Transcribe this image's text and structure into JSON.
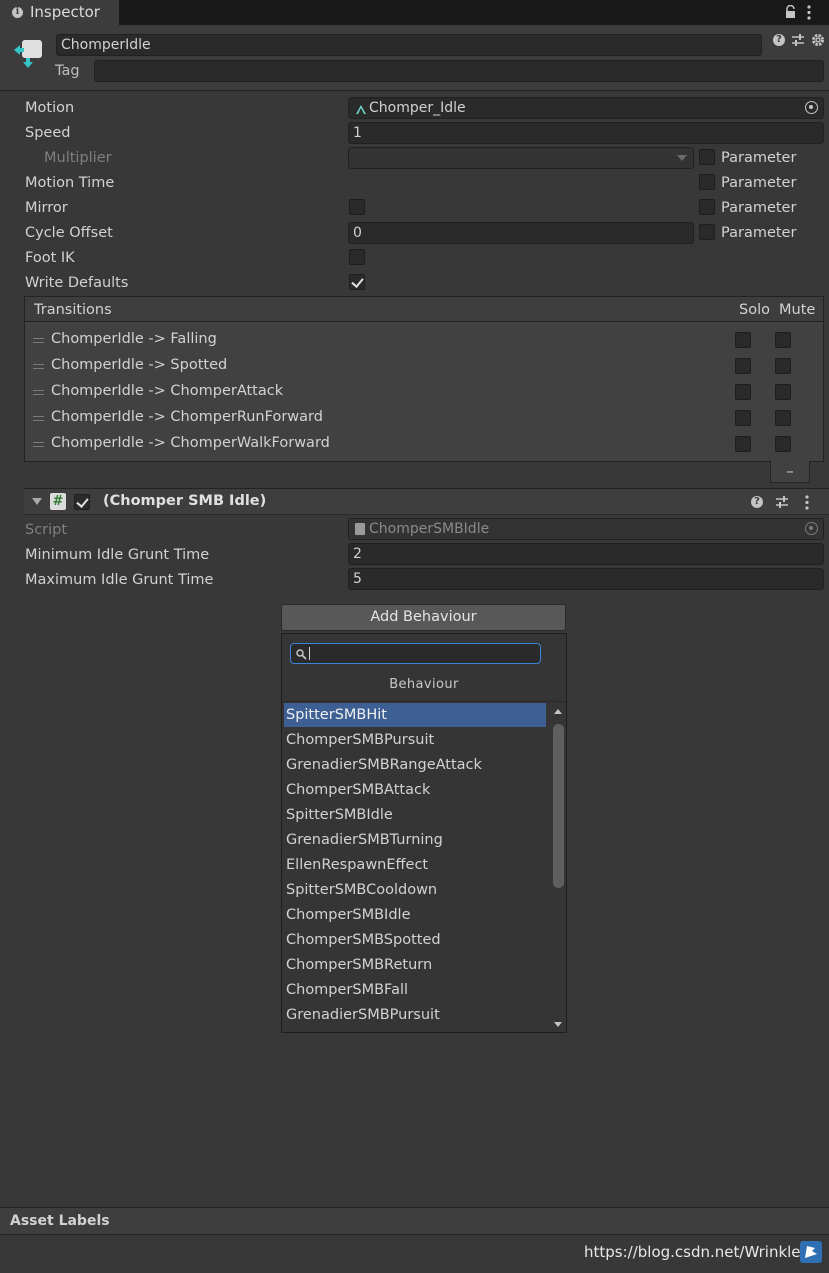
{
  "tab": {
    "icon": "info-icon",
    "title": "Inspector"
  },
  "header": {
    "name_value": "ChomperIdle",
    "tag_label": "Tag",
    "tag_value": ""
  },
  "motion": {
    "motion_label": "Motion",
    "motion_value": "Chomper_Idle",
    "speed_label": "Speed",
    "speed_value": "1",
    "multiplier_label": "Multiplier",
    "motion_time_label": "Motion Time",
    "mirror_label": "Mirror",
    "cycle_offset_label": "Cycle Offset",
    "cycle_offset_value": "0",
    "foot_ik_label": "Foot IK",
    "write_defaults_label": "Write Defaults",
    "parameter_label": "Parameter",
    "mirror_checked": false,
    "foot_ik_checked": false,
    "write_defaults_checked": true
  },
  "transitions": {
    "header": "Transitions",
    "solo": "Solo",
    "mute": "Mute",
    "remove": "–",
    "items": [
      "ChomperIdle -> Falling",
      "ChomperIdle -> Spotted",
      "ChomperIdle -> ChomperAttack",
      "ChomperIdle -> ChomperRunForward",
      "ChomperIdle -> ChomperWalkForward"
    ]
  },
  "behaviour": {
    "title": "(Chomper SMB Idle)",
    "script_label": "Script",
    "script_value": "ChomperSMBIdle",
    "min_label": "Minimum Idle Grunt Time",
    "min_value": "2",
    "max_label": "Maximum Idle Grunt Time",
    "max_value": "5"
  },
  "add_behaviour": {
    "button": "Add Behaviour",
    "search_value": "",
    "category": "Behaviour",
    "items": [
      "SpitterSMBHit",
      "ChomperSMBPursuit",
      "GrenadierSMBRangeAttack",
      "ChomperSMBAttack",
      "SpitterSMBIdle",
      "GrenadierSMBTurning",
      "EllenRespawnEffect",
      "SpitterSMBCooldown",
      "ChomperSMBIdle",
      "ChomperSMBSpotted",
      "ChomperSMBReturn",
      "ChomperSMBFall",
      "GrenadierSMBPursuit"
    ],
    "selected_index": 0
  },
  "footer": {
    "asset_labels": "Asset Labels"
  },
  "watermark": "https://blog.csdn.net/Wrinkle20"
}
